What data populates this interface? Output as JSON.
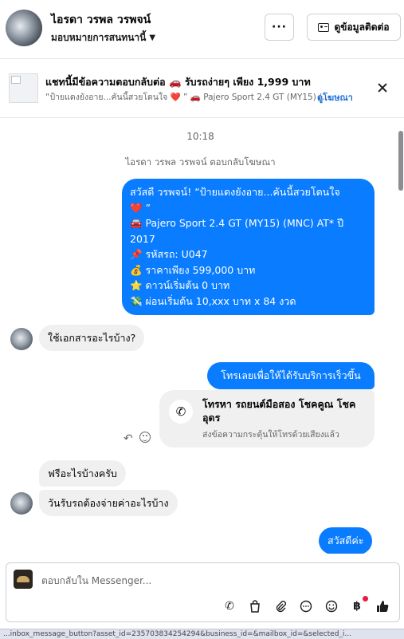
{
  "header": {
    "contact_name": "ไอรดา วรพล วรพจน์",
    "assignment_label": "มอบหมายการสนทนานี้",
    "more_label": "···",
    "contact_info_label": "ดูข้อมูลติดต่อ"
  },
  "ad_banner": {
    "title": "แชทนี้มีข้อความตอบกลับต่อ 🚗 รับรถง่ายๆ เพียง 1,999 บาท",
    "subtitle": "“ป้ายแดงยังอาย...คันนี้สวยโดนใจ ❤️ ” 🚗 Pajero Sport 2.4 GT (MY15) (...",
    "view_ad_link": "ดูโฆษณา"
  },
  "thread": {
    "timestamp": "10:18",
    "system_message": "ไอรดา วรพล วรพจน์ ตอบกลับโฆษณา",
    "messages": [
      {
        "direction": "outgoing",
        "lines": [
          "สวัสดี วรพจน์! “ป้ายแดงยังอาย...คันนี้สวยโดนใจ",
          "❤️ ”",
          "🚘 Pajero Sport 2.4 GT (MY15) (MNC) AT* ปี",
          "2017",
          "📌 รหัสรถ: U047",
          "💰 ราคาเพียง 599,000 บาท",
          "⭐ ดาวน์เริ่มต้น 0 บาท",
          "💸 ผ่อนเริ่มต้น 10,xxx บาท x 84 งวด"
        ]
      },
      {
        "direction": "incoming",
        "text": "ใช้เอกสารอะไรบ้าง?"
      },
      {
        "direction": "outgoing",
        "text": "โทรเลยเพื่อให้ได้รับบริการเร็วขึ้น"
      },
      {
        "direction": "outgoing",
        "type": "call_card",
        "title": "โทรหา รถยนต์มือสอง โชคคูณ โชค อุดร",
        "subtitle": "ส่งข้อความกระตุ้นให้โทรด้วยเสียงแล้ว"
      },
      {
        "direction": "incoming",
        "text": "ฟรีอะไรบ้างครับ"
      },
      {
        "direction": "incoming",
        "text": "วันรับรถต้องจ่ายค่าอะไรบ้าง"
      },
      {
        "direction": "outgoing",
        "text": "สวัสดีค่ะ"
      }
    ]
  },
  "composer": {
    "placeholder": "ตอบกลับใน Messenger...",
    "tools": [
      "call-add-icon",
      "shopping-bag-icon",
      "paperclip-icon",
      "chat-bubble-icon",
      "emoji-icon",
      "currency-icon",
      "thumbs-up-icon"
    ]
  },
  "status_bar_text": "...inbox_message_button?asset_id=235703834254294&business_id=&mailbox_id=&selected_i...",
  "colors": {
    "outgoing_bubble": "#0a7cff",
    "incoming_bubble": "#f0f0f0",
    "link": "#216fdb",
    "notification_dot": "#e41e3f"
  }
}
